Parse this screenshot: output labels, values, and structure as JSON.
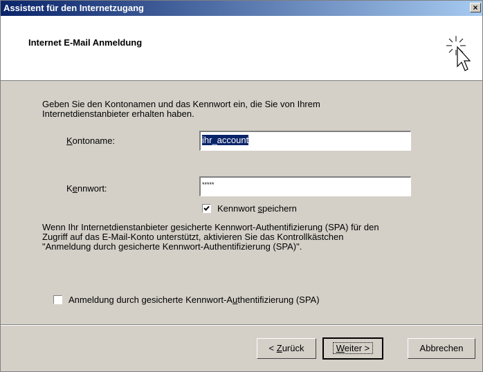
{
  "window": {
    "title": "Assistent für den Internetzugang",
    "close_glyph": "×"
  },
  "header": {
    "title": "Internet E-Mail Anmeldung",
    "icon": "wizard-sparkle-cursor-icon"
  },
  "intro": {
    "line1": "Geben Sie den Kontonamen und das Kennwort ein, die Sie von Ihrem",
    "line2": "Internetdienstanbieter erhalten haben."
  },
  "account": {
    "label_accel": "K",
    "label_rest": "ontoname:",
    "value": "ihr_account"
  },
  "password": {
    "label_pre": "K",
    "label_accel": "e",
    "label_rest": "nnwort:",
    "value": "*****"
  },
  "save_password": {
    "checked": true,
    "label_pre": "Kennwort ",
    "label_accel": "s",
    "label_rest": "peichern"
  },
  "spa_info": {
    "line1": "Wenn Ihr Internetdienstanbieter gesicherte Kennwort-Authentifizierung (SPA) für den",
    "line2": "Zugriff auf das E-Mail-Konto unterstützt, aktivieren Sie das Kontrollkästchen",
    "line3": "\"Anmeldung durch gesicherte Kennwort-Authentifizierung (SPA)\"."
  },
  "spa_checkbox": {
    "checked": false,
    "label_pre": "Anmeldung durch gesicherte Kennwort-A",
    "label_accel": "u",
    "label_rest": "thentifizierung (SPA)"
  },
  "buttons": {
    "back": {
      "pre": "< ",
      "accel": "Z",
      "rest": "urück"
    },
    "next": {
      "accel": "W",
      "rest": "eiter >"
    },
    "cancel": {
      "label": "Abbrechen"
    }
  },
  "colors": {
    "titlebar_start": "#0a246a",
    "titlebar_end": "#a6caf0",
    "face": "#d4d0c8",
    "selection": "#0a246a"
  }
}
